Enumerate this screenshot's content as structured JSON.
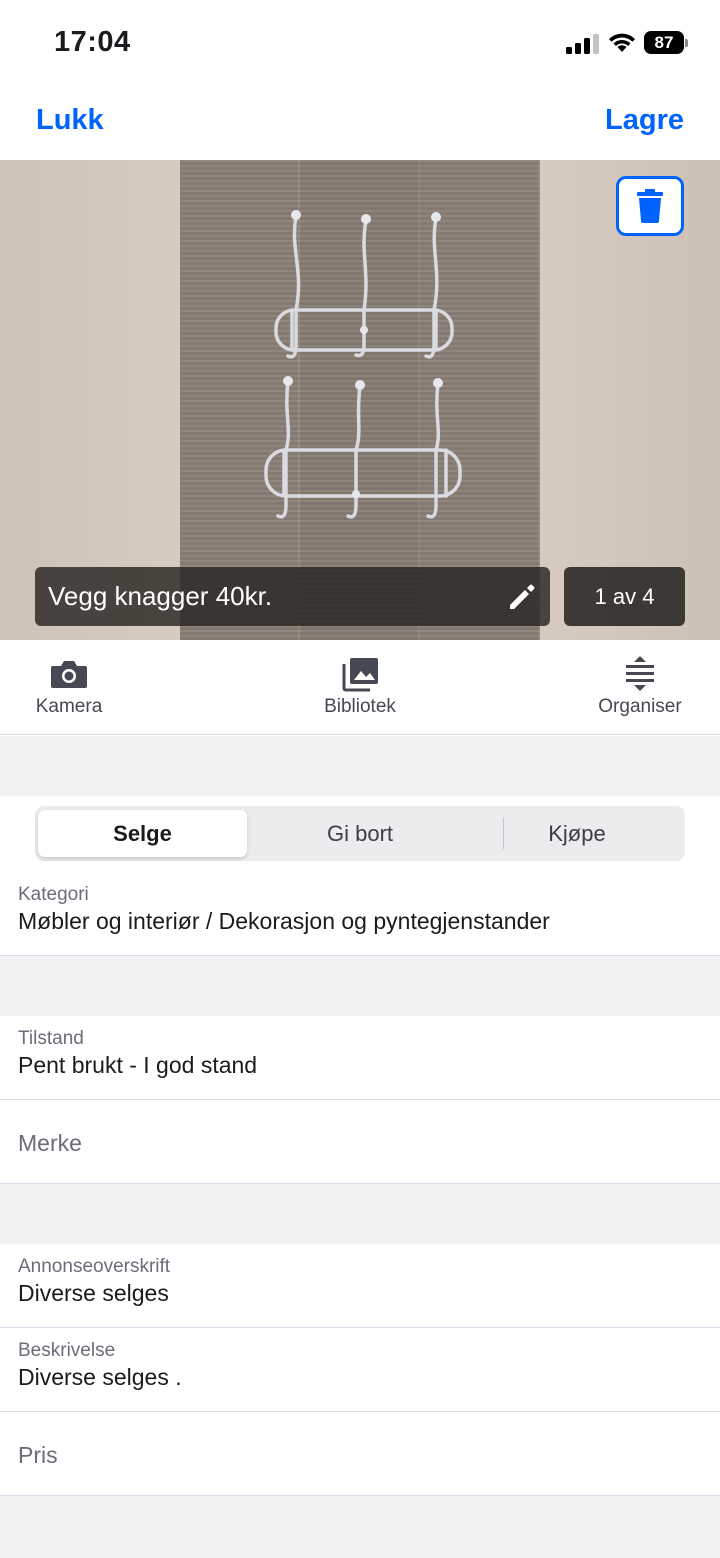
{
  "status_bar": {
    "time": "17:04",
    "battery": "87"
  },
  "nav": {
    "close_label": "Lukk",
    "save_label": "Lagre"
  },
  "photo": {
    "caption": "Vegg knagger 40kr.",
    "counter": "1 av 4"
  },
  "toolbar": {
    "camera_label": "Kamera",
    "library_label": "Bibliotek",
    "organize_label": "Organiser"
  },
  "segments": {
    "sell": "Selge",
    "give": "Gi bort",
    "buy": "Kjøpe",
    "selected": "Selge"
  },
  "fields": {
    "category": {
      "label": "Kategori",
      "value": "Møbler og interiør / Dekorasjon og pyntegjenstander"
    },
    "condition": {
      "label": "Tilstand",
      "value": "Pent brukt - I god stand"
    },
    "brand": {
      "placeholder": "Merke"
    },
    "headline": {
      "label": "Annonseoverskrift",
      "value": "Diverse selges"
    },
    "description": {
      "label": "Beskrivelse",
      "value": "Diverse selges ."
    },
    "price": {
      "placeholder": "Pris"
    }
  },
  "colors": {
    "accent": "#0063fb",
    "background_band": "#f1f1f3"
  }
}
